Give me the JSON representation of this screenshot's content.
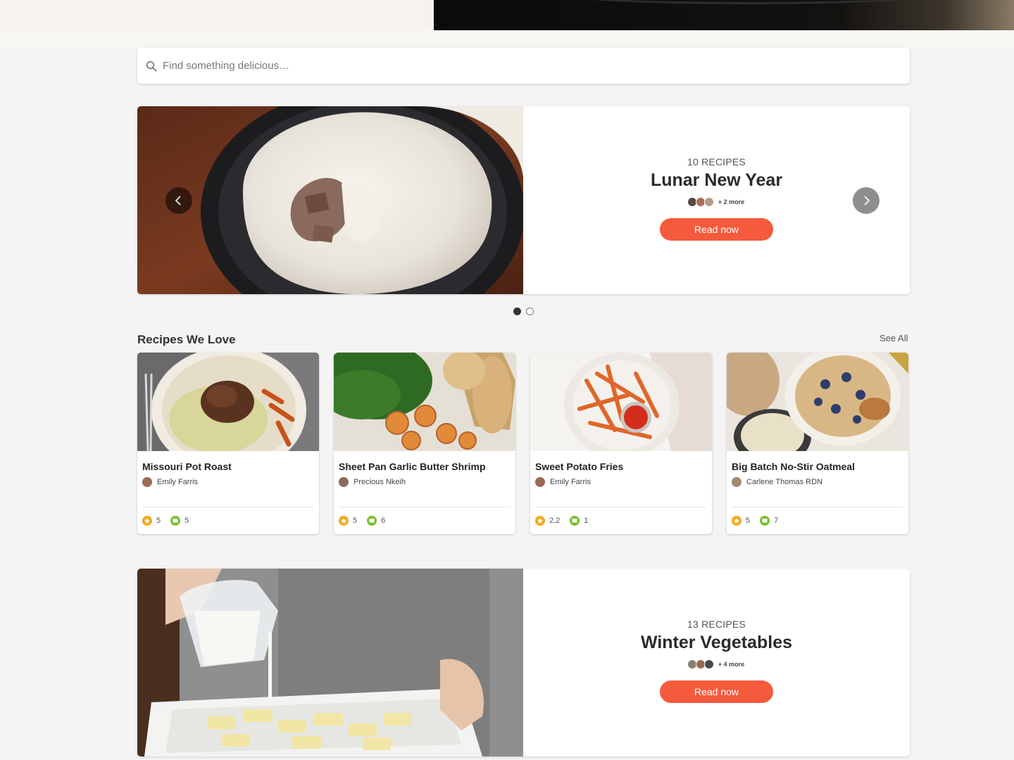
{
  "search": {
    "placeholder": "Find something delicious…"
  },
  "carousel": {
    "count": "10 RECIPES",
    "title": "Lunar New Year",
    "more": "+ 2 more",
    "cta": "Read now",
    "active_slide": 1,
    "total_slides": 2
  },
  "section": {
    "title": "Recipes We Love",
    "see_all": "See All"
  },
  "recipes": [
    {
      "title": "Missouri Pot Roast",
      "author": "Emily Farris",
      "rating": "5",
      "comments": "5"
    },
    {
      "title": "Sheet Pan Garlic Butter Shrimp",
      "author": "Precious Nkeih",
      "rating": "5",
      "comments": "6"
    },
    {
      "title": "Sweet Potato Fries",
      "author": "Emily Farris",
      "rating": "2.2",
      "comments": "1"
    },
    {
      "title": "Big Batch No-Stir Oatmeal",
      "author": "Carlene Thomas RDN",
      "rating": "5",
      "comments": "7"
    }
  ],
  "feature2": {
    "count": "13 RECIPES",
    "title": "Winter Vegetables",
    "more": "+ 4 more",
    "cta": "Read now"
  },
  "colors": {
    "accent": "#f55a3c",
    "star": "#f2a81d",
    "comment": "#7bbf2f",
    "background": "#f4f4f4"
  }
}
